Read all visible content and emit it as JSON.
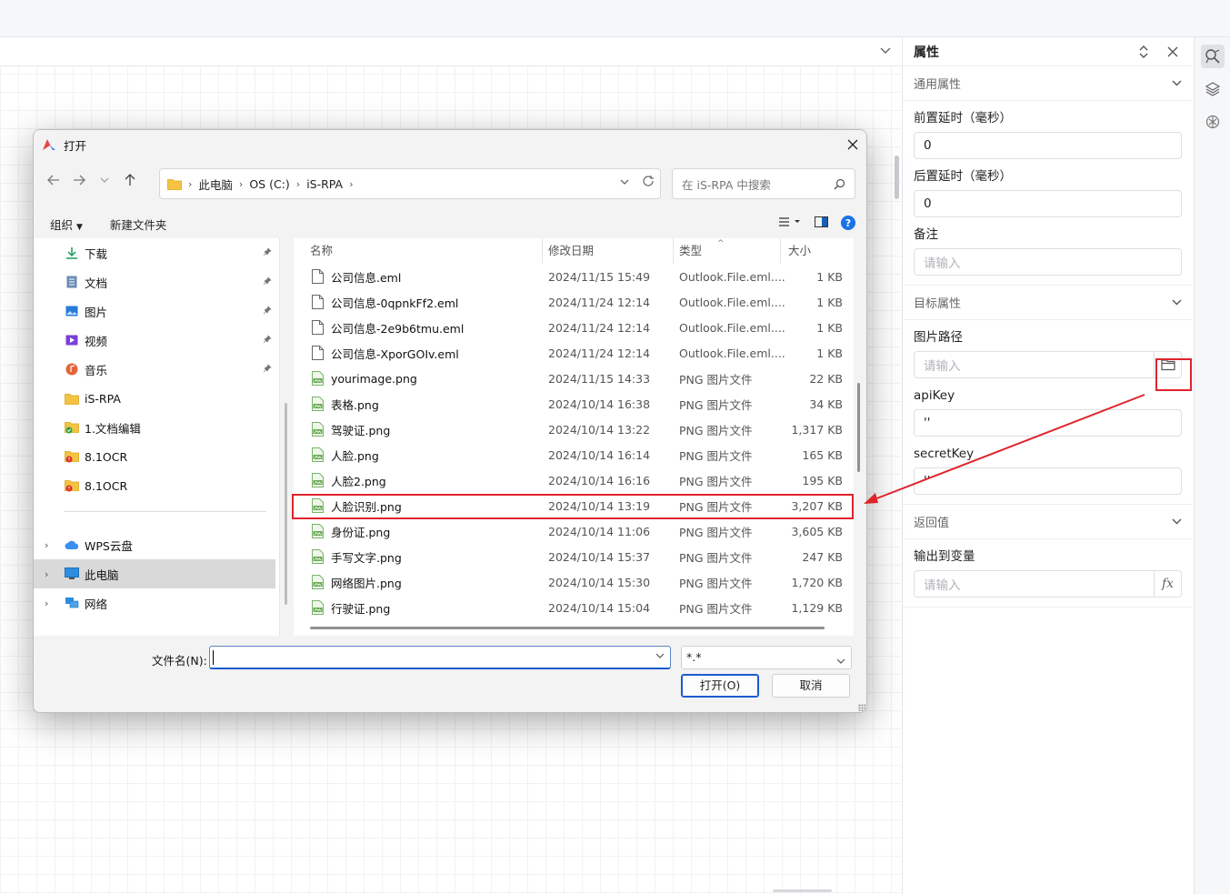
{
  "panel": {
    "title": "属性",
    "general_section": "通用属性",
    "pre_delay_label": "前置延时（毫秒）",
    "pre_delay_value": "0",
    "post_delay_label": "后置延时（毫秒）",
    "post_delay_value": "0",
    "note_label": "备注",
    "note_placeholder": "请输入",
    "target_section": "目标属性",
    "image_path_label": "图片路径",
    "image_path_placeholder": "请输入",
    "apikey_label": "apiKey",
    "apikey_value": "''",
    "secretkey_label": "secretKey",
    "secretkey_value": "''",
    "return_section": "返回值",
    "output_label": "输出到变量",
    "output_placeholder": "请输入",
    "fx_label": "fx"
  },
  "dialog": {
    "title": "打开",
    "breadcrumb": [
      "此电脑",
      "OS (C:)",
      "iS-RPA"
    ],
    "search_placeholder": "在 iS-RPA 中搜索",
    "toolbar": {
      "organize": "组织",
      "new_folder": "新建文件夹"
    },
    "nav_items": [
      {
        "label": "下载",
        "icon": "download-icon",
        "pinned": true
      },
      {
        "label": "文档",
        "icon": "document-icon",
        "pinned": true
      },
      {
        "label": "图片",
        "icon": "pictures-icon",
        "pinned": true
      },
      {
        "label": "视频",
        "icon": "video-icon",
        "pinned": true
      },
      {
        "label": "音乐",
        "icon": "music-icon",
        "pinned": true
      },
      {
        "label": "iS-RPA",
        "icon": "folder-icon",
        "pinned": false
      },
      {
        "label": "1.文档编辑",
        "icon": "folder-check-icon",
        "pinned": false
      },
      {
        "label": "8.1OCR",
        "icon": "folder-error-icon",
        "pinned": false
      },
      {
        "label": "8.1OCR",
        "icon": "folder-error-icon",
        "pinned": false
      }
    ],
    "tree_items": [
      {
        "label": "WPS云盘",
        "icon": "cloud-icon"
      },
      {
        "label": "此电脑",
        "icon": "computer-icon"
      },
      {
        "label": "网络",
        "icon": "network-icon"
      }
    ],
    "columns": {
      "name": "名称",
      "date": "修改日期",
      "type": "类型",
      "size": "大小"
    },
    "files": [
      {
        "name": "公司信息.eml",
        "date": "2024/11/15 15:49",
        "type": "Outlook.File.eml....",
        "size": "1 KB",
        "kind": "eml"
      },
      {
        "name": "公司信息-0qpnkFf2.eml",
        "date": "2024/11/24 12:14",
        "type": "Outlook.File.eml....",
        "size": "1 KB",
        "kind": "eml"
      },
      {
        "name": "公司信息-2e9b6tmu.eml",
        "date": "2024/11/24 12:14",
        "type": "Outlook.File.eml....",
        "size": "1 KB",
        "kind": "eml"
      },
      {
        "name": "公司信息-XporGOIv.eml",
        "date": "2024/11/24 12:14",
        "type": "Outlook.File.eml....",
        "size": "1 KB",
        "kind": "eml"
      },
      {
        "name": "yourimage.png",
        "date": "2024/11/15 14:33",
        "type": "PNG 图片文件",
        "size": "22 KB",
        "kind": "png"
      },
      {
        "name": "表格.png",
        "date": "2024/10/14 16:38",
        "type": "PNG 图片文件",
        "size": "34 KB",
        "kind": "png"
      },
      {
        "name": "驾驶证.png",
        "date": "2024/10/14 13:22",
        "type": "PNG 图片文件",
        "size": "1,317 KB",
        "kind": "png"
      },
      {
        "name": "人脸.png",
        "date": "2024/10/14 16:14",
        "type": "PNG 图片文件",
        "size": "165 KB",
        "kind": "png"
      },
      {
        "name": "人脸2.png",
        "date": "2024/10/14 16:16",
        "type": "PNG 图片文件",
        "size": "195 KB",
        "kind": "png"
      },
      {
        "name": "人脸识别.png",
        "date": "2024/10/14 13:19",
        "type": "PNG 图片文件",
        "size": "3,207 KB",
        "kind": "png"
      },
      {
        "name": "身份证.png",
        "date": "2024/10/14 11:06",
        "type": "PNG 图片文件",
        "size": "3,605 KB",
        "kind": "png"
      },
      {
        "name": "手写文字.png",
        "date": "2024/10/14 15:37",
        "type": "PNG 图片文件",
        "size": "247 KB",
        "kind": "png"
      },
      {
        "name": "网络图片.png",
        "date": "2024/10/14 15:30",
        "type": "PNG 图片文件",
        "size": "1,720 KB",
        "kind": "png"
      },
      {
        "name": "行驶证.png",
        "date": "2024/10/14 15:04",
        "type": "PNG 图片文件",
        "size": "1,129 KB",
        "kind": "png"
      }
    ],
    "filename_label": "文件名(N):",
    "filename_value": "",
    "filetype_value": "*.*",
    "open_button": "打开(O)",
    "cancel_button": "取消"
  },
  "colors": {
    "highlight": "#e0232b",
    "accent": "#1c5bd1"
  }
}
